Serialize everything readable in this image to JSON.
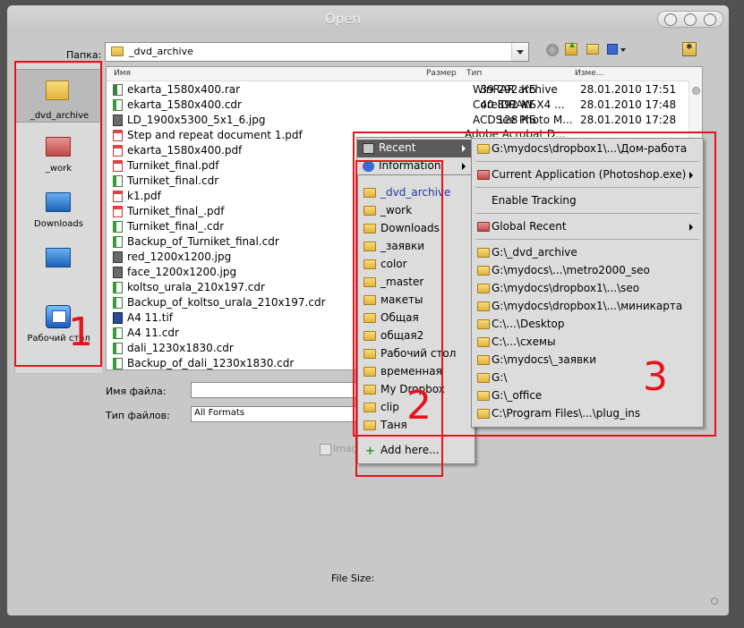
{
  "window": {
    "title": "Open"
  },
  "folder": {
    "label": "Папка:",
    "value": "_dvd_archive"
  },
  "places": [
    {
      "label": "_dvd_archive",
      "color": "#f2c94c"
    },
    {
      "label": "_work",
      "color": "#c0322f"
    },
    {
      "label": "Downloads",
      "color": "#2a78c8"
    },
    {
      "label": "",
      "color": "#2a78c8"
    },
    {
      "label": "Рабочий стол",
      "color": "#1f6fd0"
    }
  ],
  "columns": {
    "name": "Имя",
    "size": "Размер",
    "type": "Тип",
    "modified": "Изме..."
  },
  "files": [
    {
      "icon": "rar",
      "name": "ekarta_1580x400.rar",
      "size": "39 292 КБ",
      "type": "WinRAR archive",
      "date": "28.01.2010 17:51"
    },
    {
      "icon": "cdr",
      "name": "ekarta_1580x400.cdr",
      "size": "40 892 КБ",
      "type": "CorelDRAW X4 ...",
      "date": "28.01.2010 17:48"
    },
    {
      "icon": "jpg",
      "name": "LD_1900x5300_5x1_6.jpg",
      "size": "128 КБ",
      "type": "ACDSee Photo M...",
      "date": "28.01.2010 17:28"
    },
    {
      "icon": "pdf",
      "name": "Step and repeat document 1.pdf",
      "size": "",
      "type": "",
      "date": ""
    },
    {
      "icon": "pdf",
      "name": "ekarta_1580x400.pdf",
      "size": "",
      "type": "",
      "date": ""
    },
    {
      "icon": "pdf",
      "name": "Turniket_final.pdf",
      "size": "",
      "type": "",
      "date": ""
    },
    {
      "icon": "cdr",
      "name": "Turniket_final.cdr",
      "size": "",
      "type": "",
      "date": ""
    },
    {
      "icon": "pdf",
      "name": "k1.pdf",
      "size": "",
      "type": "",
      "date": ""
    },
    {
      "icon": "pdf",
      "name": "Turniket_final_.pdf",
      "size": "",
      "type": "",
      "date": ""
    },
    {
      "icon": "cdr",
      "name": "Turniket_final_.cdr",
      "size": "",
      "type": "",
      "date": ""
    },
    {
      "icon": "cdr",
      "name": "Backup_of_Turniket_final.cdr",
      "size": "",
      "type": "",
      "date": ""
    },
    {
      "icon": "jpg",
      "name": "red_1200x1200.jpg",
      "size": "",
      "type": "",
      "date": ""
    },
    {
      "icon": "jpg",
      "name": "face_1200x1200.jpg",
      "size": "",
      "type": "",
      "date": ""
    },
    {
      "icon": "cdr",
      "name": "koltso_urala_210x197.cdr",
      "size": "",
      "type": "",
      "date": ""
    },
    {
      "icon": "cdr",
      "name": "Backup_of_koltso_urala_210x197.cdr",
      "size": "",
      "type": "",
      "date": ""
    },
    {
      "icon": "tif",
      "name": "A4 11.tif",
      "size": "",
      "type": "",
      "date": ""
    },
    {
      "icon": "cdr",
      "name": "A4 11.cdr",
      "size": "",
      "type": "",
      "date": ""
    },
    {
      "icon": "cdr",
      "name": "dali_1230x1830.cdr",
      "size": "",
      "type": "",
      "date": ""
    },
    {
      "icon": "cdr",
      "name": "Backup_of_dali_1230x1830.cdr",
      "size": "",
      "type": "",
      "date": ""
    }
  ],
  "peek": {
    "type_behind_menu": "Adobe Acrobat D..."
  },
  "filename": {
    "label": "Имя файла:",
    "value": ""
  },
  "filetype": {
    "label": "Тип файлов:",
    "value": "All Formats"
  },
  "image_sequence": {
    "label": "Imag"
  },
  "file_size": {
    "label": "File Size:"
  },
  "main_menu": [
    {
      "label": "Recent",
      "highlighted": true
    },
    {
      "label": "Information"
    }
  ],
  "folders_menu": {
    "items": [
      "_dvd_archive",
      "_work",
      "Downloads",
      "_заявки",
      "color",
      "_master",
      "макеты",
      "Общая",
      "общая2",
      "Рабочий стол",
      "временная",
      "My Dropbox",
      "clip",
      "Таня"
    ],
    "add_here": "Add here..."
  },
  "recent_menu": {
    "top": "G:\\mydocs\\dropbox1\\...\\Дом-работа",
    "current_app": "Current Application (Photoshop.exe)",
    "enable_tracking": "Enable Tracking",
    "global_recent": "Global Recent",
    "paths": [
      "G:\\_dvd_archive",
      "G:\\mydocs\\...\\metro2000_seo",
      "G:\\mydocs\\dropbox1\\...\\seo",
      "G:\\mydocs\\dropbox1\\...\\миникарта",
      "C:\\...\\Desktop",
      "C:\\...\\схемы",
      "G:\\mydocs\\_заявки",
      "G:\\",
      "G:\\_office",
      "C:\\Program Files\\...\\plug_ins"
    ]
  },
  "annotations": [
    "1",
    "2",
    "3"
  ],
  "colors": {
    "annotation": "#e8121c",
    "menu_highlight": "#5a5a5a",
    "link_selected": "#2233aa"
  }
}
